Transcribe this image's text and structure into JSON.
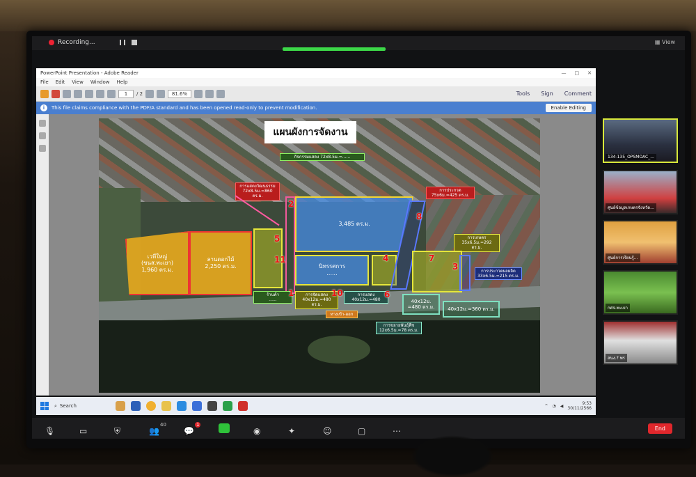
{
  "zoom": {
    "recording": "Recording...",
    "view": "View",
    "participants_count": "40",
    "chat_badge": "1",
    "end_label": "End"
  },
  "acrobat": {
    "window_title": "PowerPoint Presentation - Adobe Reader",
    "window_controls": [
      "—",
      "□",
      "✕"
    ],
    "menu": [
      "File",
      "Edit",
      "View",
      "Window",
      "Help"
    ],
    "page_current": "1",
    "page_total": "/ 2",
    "zoom_level": "81.6%",
    "right_tools": [
      "Tools",
      "Sign",
      "Comment"
    ],
    "notice": "This file claims compliance with the PDF/A standard and has been opened read-only to prevent modification.",
    "enable_editing": "Enable Editing"
  },
  "slide": {
    "title": "แผนผังการจัดงาน",
    "zones": {
      "stage_big": "เวทีใหญ่\n(ขนส.พะเยา)\n1,960 ตร.ม.",
      "flower_yard": "ลานดอกไม้\n2,250 ตร.ม.",
      "blue_area": "3,485 ตร.ม.",
      "center_block": "นิทรรศการ\n......",
      "olive_4": "",
      "olive_5": ""
    },
    "labels": {
      "top_center": "กิจกรรมแสดง 72x8.5ม.=......",
      "top_left_red": "การแสดงวัฒนธรรม\n72x8.5ม.=860 ตร.ม.",
      "right_red": "การประกวด\n75x6ม.=425 ตร.ม.",
      "right_green": "การเกษตร\n35x6.5ม.=292 ตร.ม.",
      "right_blue": "การประกวดผลผลิต\n33x6.5ม.=215 ตร.ม.",
      "bottom_teal": "การขยายพันธุ์พืช\n12x6.5ม.=78 ตร.ม.",
      "bottom_orange": "ทางเข้า-ออก",
      "bottom_row_1": "ร้านค้า\n......",
      "bottom_row_2": "การจัดแสดง\n40x12ม.=480 ตร.ม.",
      "bottom_row_3": "การแสดง\n40x12ม.=480",
      "teal_1": "40x12ม.\n=480 ตร.ม.",
      "teal_2": "40x12ม.=360 ตร.ม."
    },
    "numbers": [
      "2",
      "5",
      "11",
      "1",
      "10",
      "4",
      "6",
      "7",
      "3",
      "8"
    ]
  },
  "taskbar": {
    "search": "Search",
    "time": "9:53",
    "date": "30/11/2566"
  },
  "tiles": [
    {
      "name": "134-135_OPSMOAC_..."
    },
    {
      "name": "ศูนย์ข้อมูลเกษตรจังหวัด..."
    },
    {
      "name": "ศูนย์การเรียนรู้..."
    },
    {
      "name": "กศจ.พะเยา"
    },
    {
      "name": "สนง.? พร"
    }
  ],
  "colors": {
    "zoom_green": "#3cd848",
    "end_red": "#e0272c",
    "notice_blue": "#4a7fd0",
    "active_speaker": "#d8e83a"
  }
}
